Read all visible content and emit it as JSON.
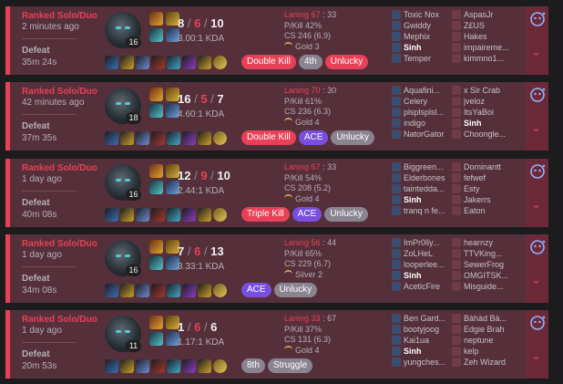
{
  "games": [
    {
      "queue": "Ranked Solo/Duo",
      "time_ago": "2 minutes ago",
      "result": "Defeat",
      "duration": "35m 24s",
      "level": "16",
      "kills": "8",
      "deaths": "6",
      "assists": "10",
      "kda_ratio": "3.00:1 KDA",
      "laning": "Laning 67",
      "laning_opp": ": 33",
      "pkill": "P/Kill 42%",
      "cs": "CS 246 (6.9)",
      "tier": "Gold 3",
      "badges": [
        {
          "label": "Double Kill",
          "kind": "kill"
        },
        {
          "label": "4th",
          "kind": "gray"
        },
        {
          "label": "Unlucky",
          "kind": "kill"
        }
      ],
      "team_blue": [
        "Toxic Nox",
        "Gwiddy",
        "Mephix",
        "Sinh",
        "Temper"
      ],
      "team_red": [
        "AspasJr",
        "Z£US",
        "Hakes",
        "impaireme...",
        "kimmno1..."
      ]
    },
    {
      "queue": "Ranked Solo/Duo",
      "time_ago": "42 minutes ago",
      "result": "Defeat",
      "duration": "37m 35s",
      "level": "18",
      "kills": "16",
      "deaths": "5",
      "assists": "7",
      "kda_ratio": "4.60:1 KDA",
      "laning": "Laning 70",
      "laning_opp": ": 30",
      "pkill": "P/Kill 61%",
      "cs": "CS 236 (6.3)",
      "tier": "Gold 4",
      "badges": [
        {
          "label": "Double Kill",
          "kind": "kill"
        },
        {
          "label": "ACE",
          "kind": "ace"
        },
        {
          "label": "Unlucky",
          "kind": "gray"
        }
      ],
      "team_blue": [
        "Aquafini...",
        "Celery",
        "plsplsplsl...",
        "indigo",
        "NatorGator"
      ],
      "team_red": [
        "x Sir Crab",
        "jveloz",
        "ItsYaBoi",
        "Sinh",
        "Choongle..."
      ]
    },
    {
      "queue": "Ranked Solo/Duo",
      "time_ago": "1 day ago",
      "result": "Defeat",
      "duration": "40m 08s",
      "level": "16",
      "kills": "12",
      "deaths": "9",
      "assists": "10",
      "kda_ratio": "2.44:1 KDA",
      "laning": "Laning 67",
      "laning_opp": ": 33",
      "pkill": "P/Kill 54%",
      "cs": "CS 208 (5.2)",
      "tier": "Gold 4",
      "badges": [
        {
          "label": "Triple Kill",
          "kind": "kill"
        },
        {
          "label": "ACE",
          "kind": "ace"
        },
        {
          "label": "Unlucky",
          "kind": "gray"
        }
      ],
      "team_blue": [
        "Biggreen...",
        "Elderbones",
        "taintedda...",
        "Sinh",
        "tranq n fe..."
      ],
      "team_red": [
        "Dominantt",
        "fefwef",
        "Esty",
        "Jakerrs",
        "Eaton"
      ]
    },
    {
      "queue": "Ranked Solo/Duo",
      "time_ago": "1 day ago",
      "result": "Defeat",
      "duration": "34m 08s",
      "level": "16",
      "kills": "7",
      "deaths": "6",
      "assists": "13",
      "kda_ratio": "3.33:1 KDA",
      "laning": "Laning 56",
      "laning_opp": ": 44",
      "pkill": "P/Kill 65%",
      "cs": "CS 229 (6.7)",
      "tier": "Silver 2",
      "badges": [
        {
          "label": "ACE",
          "kind": "ace"
        },
        {
          "label": "Unlucky",
          "kind": "gray"
        }
      ],
      "team_blue": [
        "ImPr0lly...",
        "ZoLHeL",
        "looperlee...",
        "Sinh",
        "AceticFire"
      ],
      "team_red": [
        "hearnzy",
        "TTVKing...",
        "SewerFrog",
        "OMGITSK...",
        "Misguide..."
      ]
    },
    {
      "queue": "Ranked Solo/Duo",
      "time_ago": "1 day ago",
      "result": "Defeat",
      "duration": "20m 53s",
      "level": "11",
      "kills": "1",
      "deaths": "6",
      "assists": "6",
      "kda_ratio": "1.17:1 KDA",
      "laning": "Laning 33",
      "laning_opp": ": 67",
      "pkill": "P/Kill 37%",
      "cs": "CS 131 (6.3)",
      "tier": "Gold 4",
      "badges": [
        {
          "label": "8th",
          "kind": "gray"
        },
        {
          "label": "Struggle",
          "kind": "gray"
        }
      ],
      "team_blue": [
        "Ben Gard...",
        "bootyjoog",
        "Kai1ua",
        "Sinh",
        "yungches..."
      ],
      "team_red": [
        "Bàhàd Bà...",
        "Edgie Brah",
        "neptune",
        "kelp",
        "Zeh Wizard"
      ]
    }
  ],
  "player_name": "Sinh",
  "icons": {
    "expand": "chevron-down-icon",
    "share": "share-icon",
    "tier": "tier-emblem-icon"
  },
  "colors": {
    "card_bg": "#55303a",
    "loss_accent": "#e84057",
    "ace_badge": "#7a4fe0",
    "neutral_badge": "#8a8490"
  }
}
